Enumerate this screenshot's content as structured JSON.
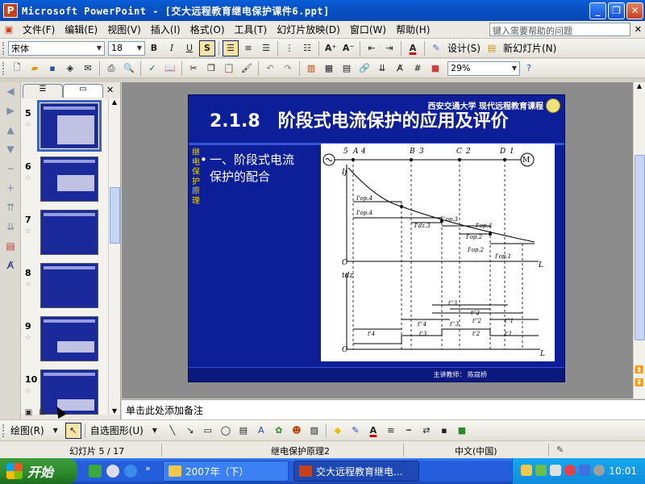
{
  "window": {
    "title": "Microsoft PowerPoint - [交大远程教育继电保护课件6.ppt]",
    "app_icon": "P"
  },
  "caption_buttons": [
    "_",
    "❐",
    "✕"
  ],
  "menu": {
    "items": [
      "文件(F)",
      "编辑(E)",
      "视图(V)",
      "插入(I)",
      "格式(O)",
      "工具(T)",
      "幻灯片放映(D)",
      "窗口(W)",
      "帮助(H)"
    ],
    "help_placeholder": "键入需要帮助的问题"
  },
  "format_toolbar": {
    "font_name": "宋体",
    "font_size": "18",
    "bold": "B",
    "italic": "I",
    "underline": "U",
    "shadow": "S",
    "font_color_glyph": "A",
    "design_label": "设计(S)",
    "new_slide_label": "新幻灯片(N)"
  },
  "standard_toolbar": {
    "zoom": "29%"
  },
  "panel_tabs": [
    "大纲",
    "幻灯片"
  ],
  "thumbnails": [
    {
      "num": "5",
      "selected": true
    },
    {
      "num": "6",
      "selected": false
    },
    {
      "num": "7",
      "selected": false
    },
    {
      "num": "8",
      "selected": false
    },
    {
      "num": "9",
      "selected": false
    },
    {
      "num": "10",
      "selected": false
    }
  ],
  "slide": {
    "title": "2.1.8　阶段式电流保护的应用及评价",
    "university": "西安交通大学 现代远程教育课程",
    "side_text": "继电保护原理",
    "bullet": "一、阶段式电流保护的配合",
    "teacher": "主讲教师： 陈寇桥",
    "figure": {
      "substations": [
        "5",
        "A",
        "4",
        "B",
        "3",
        "C",
        "2",
        "D",
        "1",
        "M"
      ],
      "axis_labels": {
        "current": "Ij",
        "distance": "L",
        "origin": "O",
        "time": "tdz"
      },
      "current_labels": [
        "I'op.4",
        "I'op.4",
        "I''op.3",
        "I'dz.3",
        "I'op.3",
        "I'op.2",
        "I'op.2",
        "I'op.1"
      ],
      "time_labels": [
        "t'4",
        "t''4",
        "t'3",
        "t''3",
        "t'2",
        "t''2",
        "t'1",
        "t''1",
        "t''3",
        "t''2"
      ]
    }
  },
  "notes": {
    "placeholder": "单击此处添加备注"
  },
  "drawing_toolbar": {
    "draw_label": "绘图(R)",
    "autoshapes_label": "自选图形(U)"
  },
  "status": {
    "slide": "幻灯片 5 / 17",
    "design": "继电保护原理2",
    "language": "中文(中国)"
  },
  "taskbar": {
    "start": "开始",
    "tasks": [
      "2007年（下）",
      "交大远程教育继电..."
    ],
    "clock": "10:01"
  }
}
